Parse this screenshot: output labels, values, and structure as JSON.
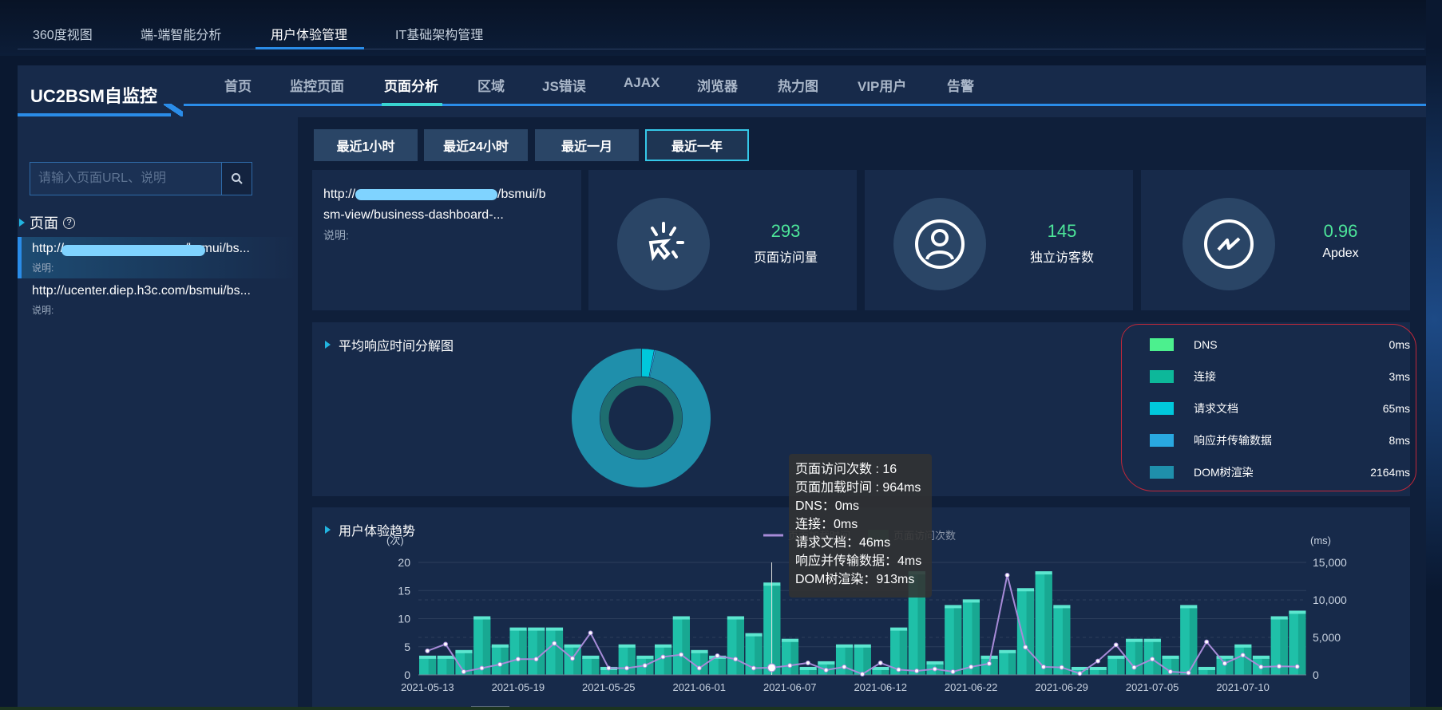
{
  "top_tabs": [
    {
      "label": "360度视图"
    },
    {
      "label": "端-端智能分析"
    },
    {
      "label": "用户体验管理",
      "active": true
    },
    {
      "label": "IT基础架构管理"
    }
  ],
  "app": {
    "title": "UC2BSM自监控"
  },
  "main_tabs": [
    {
      "label": "首页"
    },
    {
      "label": "监控页面"
    },
    {
      "label": "页面分析",
      "active": true
    },
    {
      "label": "区域"
    },
    {
      "label": "JS错误"
    },
    {
      "label": "AJAX"
    },
    {
      "label": "浏览器"
    },
    {
      "label": "热力图"
    },
    {
      "label": "VIP用户"
    },
    {
      "label": "告警"
    }
  ],
  "sidebar": {
    "search_placeholder": "请输入页面URL、说明",
    "section_title": "页面",
    "pages": [
      {
        "url": "http://...........................:ooo/bsmui/bs...",
        "desc": "说明:",
        "selected": true
      },
      {
        "url": "http://ucenter.diep.h3c.com/bsmui/bs...",
        "desc": "说明:"
      }
    ]
  },
  "time_ranges": [
    {
      "label": "最近1小时"
    },
    {
      "label": "最近24小时"
    },
    {
      "label": "最近一月"
    },
    {
      "label": "最近一年",
      "active": true
    }
  ],
  "page_info": {
    "url_line1": "http://",
    "url_line1_end": "/bsmui/b",
    "url_line2": "sm-view/business-dashboard-...",
    "desc": "说明:"
  },
  "stats": [
    {
      "value": "293",
      "label": "页面访问量",
      "icon": "click-cursor-icon"
    },
    {
      "value": "145",
      "label": "独立访客数",
      "icon": "user-icon"
    },
    {
      "value": "0.96",
      "label": "Apdex",
      "icon": "trend-icon"
    }
  ],
  "colors": {
    "accent": "#2a8ce8",
    "stat_value": "#4de69a",
    "bar": "#1fc0a8",
    "line": "#a78bd8"
  },
  "chart_data": [
    {
      "type": "pie",
      "title": "平均响应时间分解图",
      "donut": true,
      "slices": [
        {
          "name": "DNS",
          "value": 0,
          "label": "0ms",
          "color": "#4cf08e"
        },
        {
          "name": "连接",
          "value": 3,
          "label": "3ms",
          "color": "#0db89a"
        },
        {
          "name": "请求文档",
          "value": 65,
          "label": "65ms",
          "color": "#00c8dc"
        },
        {
          "name": "响应并传输数据",
          "value": 8,
          "label": "8ms",
          "color": "#29a8e0"
        },
        {
          "name": "DOM树渲染",
          "value": 2164,
          "label": "2164ms",
          "color": "#1f8fab"
        }
      ],
      "legend": "right"
    },
    {
      "type": "bar",
      "title": "用户体验趋势",
      "y_left_unit": "(次)",
      "y_right_unit": "(ms)",
      "y_left_ticks": [
        "0",
        "5",
        "10",
        "15",
        "20"
      ],
      "y_right_ticks": [
        "0",
        "5,000",
        "10,000",
        "15,000"
      ],
      "ylim_left": [
        0,
        20
      ],
      "ylim_right": [
        0,
        15000
      ],
      "x_tick_labels": [
        "2021-05-13",
        "2021-05-19",
        "2021-05-25",
        "2021-06-01",
        "2021-06-07",
        "2021-06-12",
        "2021-06-22",
        "2021-06-29",
        "2021-07-05",
        "2021-07-10"
      ],
      "series": [
        {
          "name": "页面加载时间",
          "type": "line",
          "axis": "right",
          "values": [
            3200,
            4100,
            430,
            900,
            1400,
            2100,
            2100,
            4200,
            2200,
            5600,
            900,
            900,
            1250,
            2400,
            2700,
            900,
            2550,
            2100,
            900,
            964,
            1250,
            1600,
            640,
            1070,
            100,
            1600,
            700,
            530,
            780,
            430,
            1070,
            1500,
            13300,
            3700,
            1070,
            1000,
            180,
            1850,
            4000,
            1000,
            2100,
            430,
            280,
            4400,
            1530,
            2630,
            1070,
            1140,
            1100
          ]
        },
        {
          "name": "页面访问次数",
          "type": "bar",
          "axis": "left",
          "values": [
            3,
            3,
            4,
            10,
            5,
            8,
            8,
            8,
            5,
            3,
            1,
            5,
            3,
            5,
            10,
            4,
            3,
            10,
            7,
            16,
            6,
            1,
            2,
            5,
            5,
            1,
            8,
            18,
            2,
            12,
            13,
            3,
            4,
            15,
            18,
            12,
            1,
            1,
            3,
            6,
            6,
            3,
            12,
            1,
            3,
            5,
            3,
            10,
            11
          ]
        }
      ],
      "grid": true,
      "legend": "top-center",
      "tooltip": {
        "lines": [
          "页面访问次数 : 16",
          "页面加载时间 : 964ms",
          "DNS：0ms",
          "连接：0ms",
          "请求文档：46ms",
          "响应并传输数据：4ms",
          "DOM树渲染：913ms"
        ],
        "index": 19
      }
    }
  ]
}
